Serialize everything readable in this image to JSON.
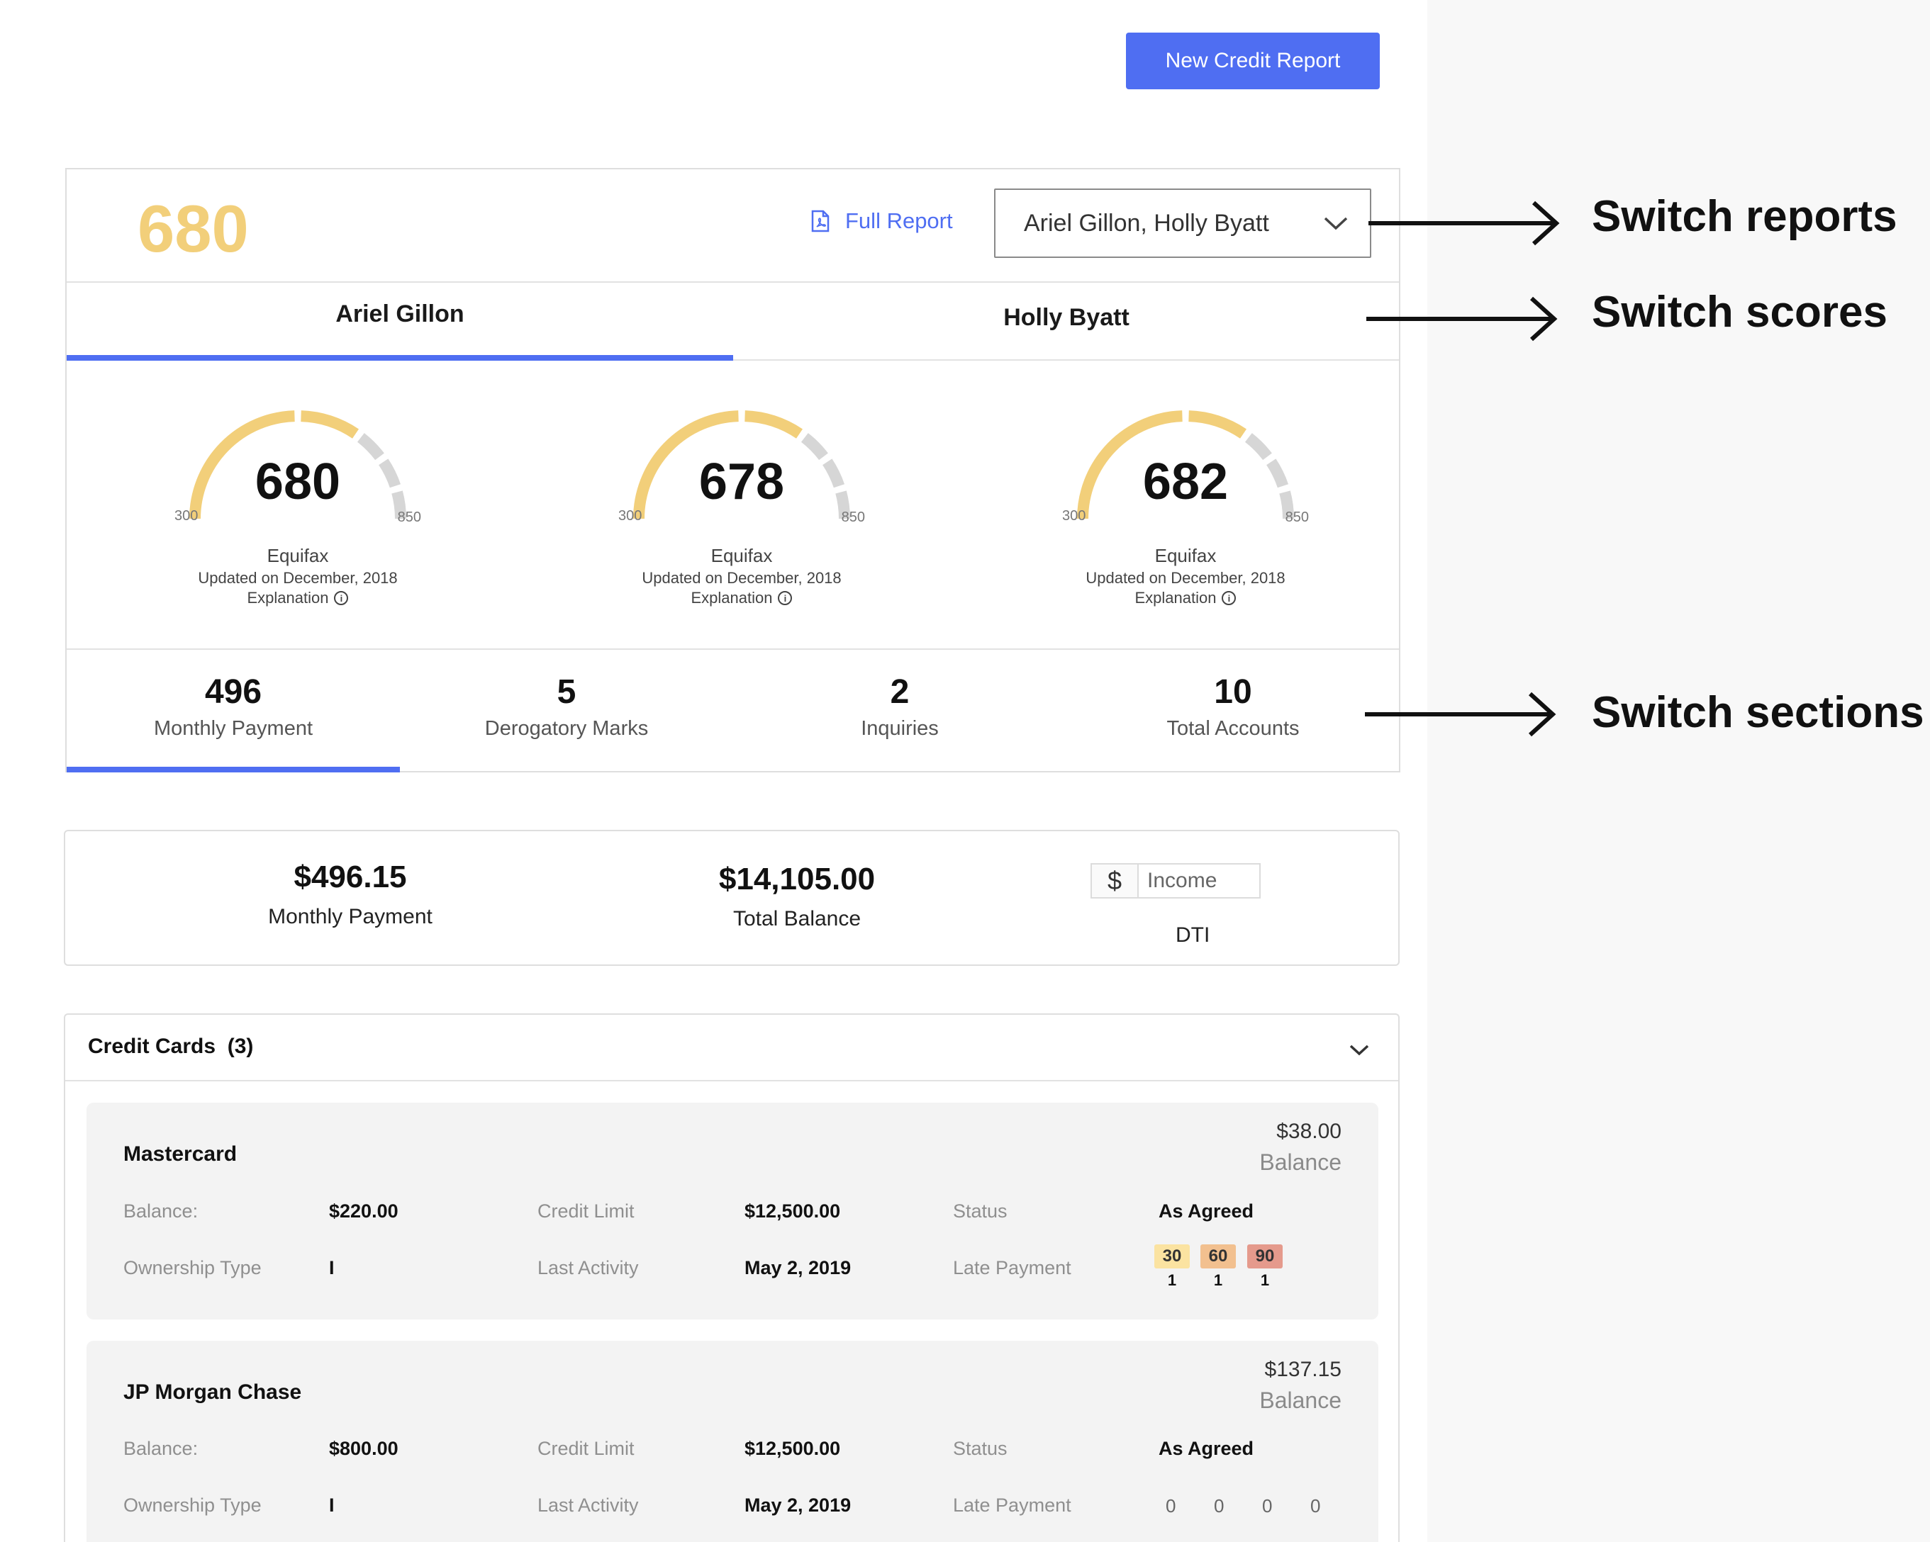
{
  "top_button": "New Credit Report",
  "score_card": {
    "big_score": "680",
    "full_report": "Full Report",
    "report_select": "Ariel Gillon, Holly Byatt",
    "tabs": [
      "Ariel Gillon",
      "Holly Byatt"
    ],
    "gauges": [
      {
        "score": "680",
        "min": "300",
        "max": "850",
        "bureau": "Equifax",
        "updated": "Updated on December, 2018",
        "explanation": "Explanation",
        "level": 0.69
      },
      {
        "score": "678",
        "min": "300",
        "max": "850",
        "bureau": "Equifax",
        "updated": "Updated on December, 2018",
        "explanation": "Explanation",
        "level": 0.69
      },
      {
        "score": "682",
        "min": "300",
        "max": "850",
        "bureau": "Equifax",
        "updated": "Updated on December, 2018",
        "explanation": "Explanation",
        "level": 0.69
      }
    ],
    "stats": [
      {
        "value": "496",
        "label": "Monthly Payment"
      },
      {
        "value": "5",
        "label": "Derogatory Marks"
      },
      {
        "value": "2",
        "label": "Inquiries"
      },
      {
        "value": "10",
        "label": "Total Accounts"
      }
    ]
  },
  "annotations": {
    "reports": "Switch reports",
    "scores": "Switch scores",
    "sections": "Switch sections"
  },
  "summary": {
    "monthly_payment": {
      "value": "$496.15",
      "label": "Monthly Payment"
    },
    "total_balance": {
      "value": "$14,105.00",
      "label": "Total Balance"
    },
    "dti": {
      "currency": "$",
      "placeholder": "Income",
      "label": "DTI"
    }
  },
  "credit_cards": {
    "title": "Credit Cards",
    "count": "(3)",
    "items": [
      {
        "name": "Mastercard",
        "balance_amount": "$38.00",
        "balance_label": "Balance",
        "balance_field_label": "Balance:",
        "balance_field_value": "$220.00",
        "credit_limit_label": "Credit Limit",
        "credit_limit_value": "$12,500.00",
        "status_label": "Status",
        "status_value": "As Agreed",
        "ownership_label": "Ownership Type",
        "ownership_value": "I",
        "last_activity_label": "Last Activity",
        "last_activity_value": "May 2, 2019",
        "late_label": "Late Payment",
        "late": [
          {
            "days": "30",
            "count": "1"
          },
          {
            "days": "60",
            "count": "1"
          },
          {
            "days": "90",
            "count": "1"
          }
        ]
      },
      {
        "name": "JP Morgan Chase",
        "balance_amount": "$137.15",
        "balance_label": "Balance",
        "balance_field_label": "Balance:",
        "balance_field_value": "$800.00",
        "credit_limit_label": "Credit Limit",
        "credit_limit_value": "$12,500.00",
        "status_label": "Status",
        "status_value": "As Agreed",
        "ownership_label": "Ownership Type",
        "ownership_value": "I",
        "last_activity_label": "Last Activity",
        "last_activity_value": "May 2, 2019",
        "late_label": "Late Payment",
        "late_zeros": [
          "0",
          "0",
          "0",
          "0"
        ]
      }
    ]
  },
  "colors": {
    "accent": "#4f6ef2",
    "score_gold": "#f2cf7a",
    "gauge_gray": "#d6d6d6",
    "late_30": "#fbe3a1",
    "late_60": "#f2c08f",
    "late_90": "#e59a8c"
  }
}
